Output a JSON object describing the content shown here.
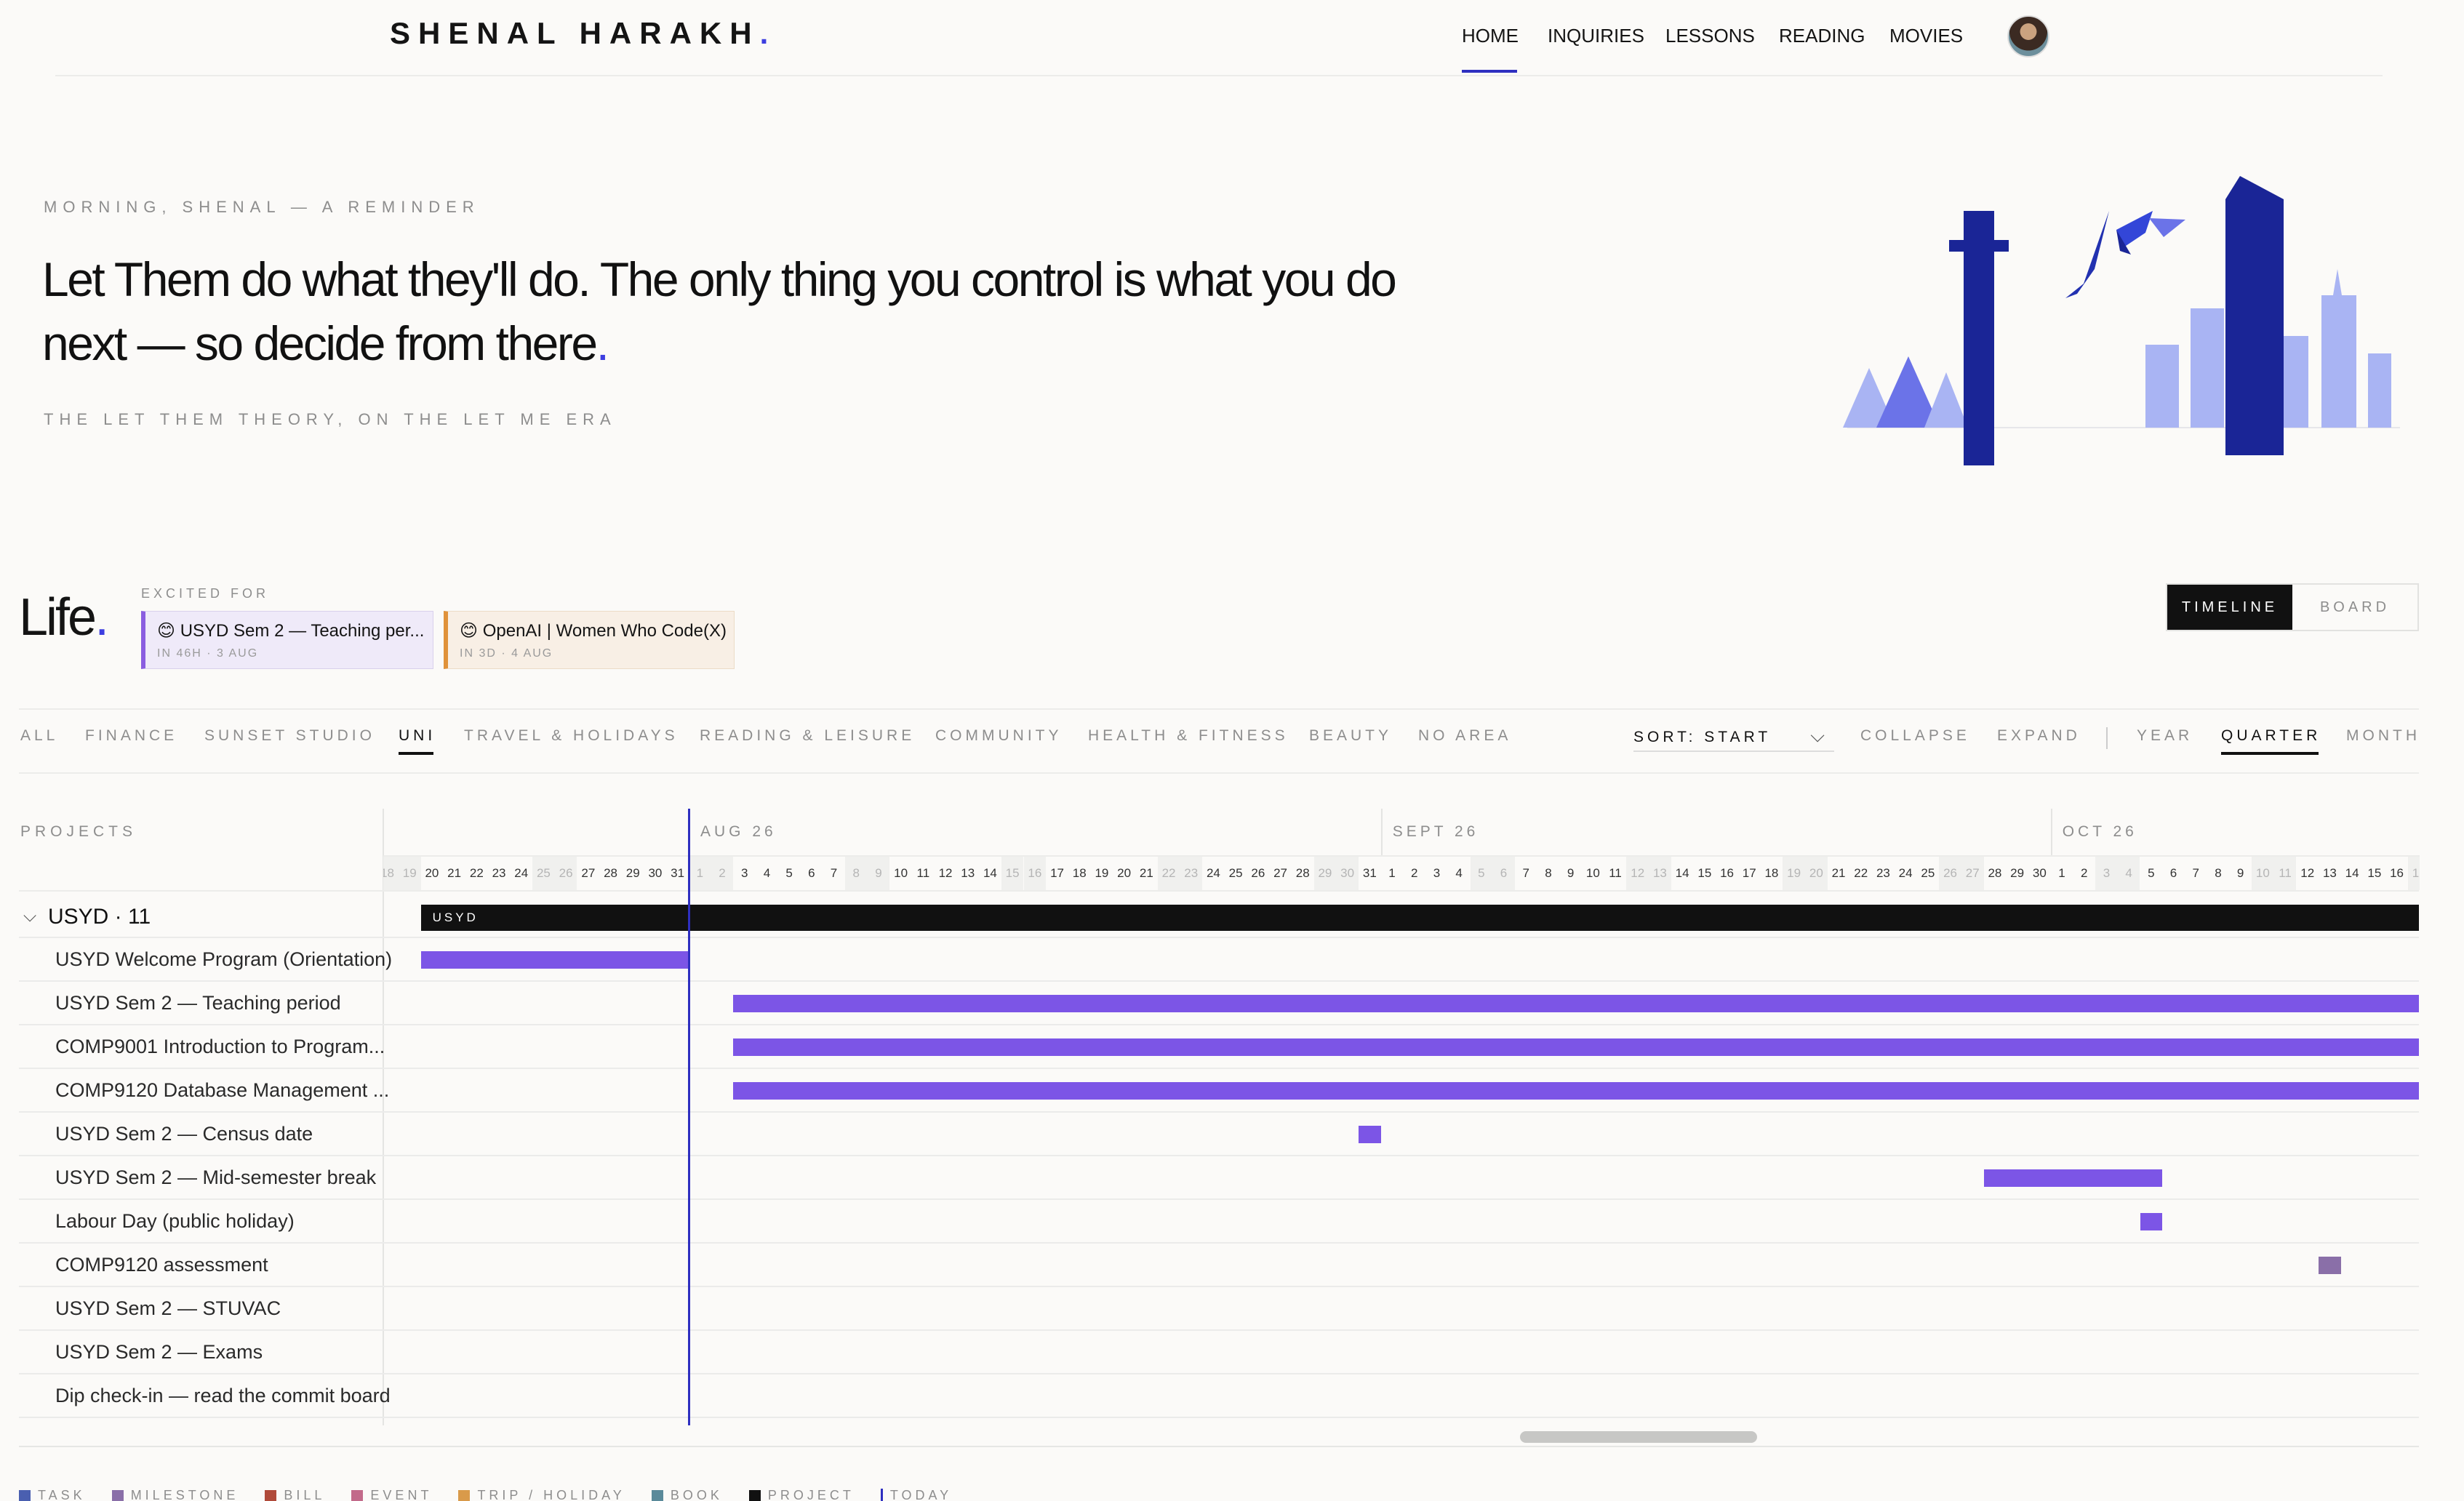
{
  "brand": {
    "name": "SHENAL HARAKH",
    "dot": "."
  },
  "nav": {
    "items": [
      "HOME",
      "INQUIRIES",
      "LESSONS",
      "READING",
      "MOVIES"
    ],
    "active": "HOME"
  },
  "hero": {
    "kicker": "MORNING, SHENAL — A REMINDER",
    "quote": "Let Them do what they'll do. The only thing you control is what you do next — so decide from there",
    "quote_dot": ".",
    "source": "THE LET THEM THEORY, ON THE LET ME ERA"
  },
  "life": {
    "title": "Life",
    "title_dot": ".",
    "excited_label": "EXCITED FOR",
    "cards": [
      {
        "emoji": "😊",
        "title": "USYD Sem 2 — Teaching per...",
        "meta": "IN 46H · 3 AUG"
      },
      {
        "emoji": "😊",
        "title": "OpenAI | Women Who Code(X)",
        "meta": "IN 3D · 4 AUG"
      }
    ],
    "view_toggle": {
      "timeline": "TIMELINE",
      "board": "BOARD",
      "active": "TIMELINE"
    }
  },
  "filters": {
    "areas": [
      "ALL",
      "FINANCE",
      "SUNSET STUDIO",
      "UNI",
      "TRAVEL & HOLIDAYS",
      "READING & LEISURE",
      "COMMUNITY",
      "HEALTH & FITNESS",
      "BEAUTY",
      "NO AREA"
    ],
    "active_area": "UNI",
    "sort": "SORT: START",
    "collapse": "COLLAPSE",
    "expand": "EXPAND",
    "scales": [
      "YEAR",
      "QUARTER",
      "MONTH"
    ],
    "active_scale": "QUARTER"
  },
  "gantt": {
    "projects_label": "PROJECTS",
    "months": [
      "AUG 26",
      "SEPT 26",
      "OCT 26"
    ],
    "today": "2026-08-01",
    "group": {
      "label": "USYD · 11",
      "bar_label": "USYD"
    },
    "rows": [
      {
        "label": "USYD Welcome Program (Orientation)",
        "start": "2026-07-20",
        "end": "2026-07-31",
        "kind": "event"
      },
      {
        "label": "USYD Sem 2 — Teaching period",
        "start": "2026-08-03",
        "end": "2026-10-17",
        "kind": "event"
      },
      {
        "label": "COMP9001 Introduction to Program...",
        "start": "2026-08-03",
        "end": "2026-10-17",
        "kind": "event"
      },
      {
        "label": "COMP9120 Database Management ...",
        "start": "2026-08-03",
        "end": "2026-10-17",
        "kind": "event"
      },
      {
        "label": "USYD Sem 2 — Census date",
        "start": "2026-08-31",
        "end": "2026-08-31",
        "kind": "event"
      },
      {
        "label": "USYD Sem 2 — Mid-semester break",
        "start": "2026-09-28",
        "end": "2026-10-05",
        "kind": "event"
      },
      {
        "label": "Labour Day (public holiday)",
        "start": "2026-10-05",
        "end": "2026-10-05",
        "kind": "event"
      },
      {
        "label": "COMP9120 assessment",
        "start": "2026-10-13",
        "end": "2026-10-13",
        "kind": "milestone"
      },
      {
        "label": "USYD Sem 2 — STUVAC",
        "start": null,
        "end": null,
        "kind": "event"
      },
      {
        "label": "USYD Sem 2 — Exams",
        "start": null,
        "end": null,
        "kind": "event"
      },
      {
        "label": "Dip check-in — read the commit board",
        "start": null,
        "end": null,
        "kind": "task"
      }
    ]
  },
  "legend": [
    {
      "label": "TASK",
      "color": "#4a5fb0"
    },
    {
      "label": "MILESTONE",
      "color": "#8a6fa8"
    },
    {
      "label": "BILL",
      "color": "#b04a3a"
    },
    {
      "label": "EVENT",
      "color": "#c26a8a"
    },
    {
      "label": "TRIP / HOLIDAY",
      "color": "#d99a4a"
    },
    {
      "label": "BOOK",
      "color": "#5a8a9a"
    },
    {
      "label": "PROJECT",
      "color": "#111111"
    },
    {
      "label": "TODAY",
      "color": "#2e2fc0"
    }
  ],
  "colors": {
    "accent": "#3d3ee0",
    "bar": "#7c55e6",
    "today": "#2e2fc0"
  }
}
